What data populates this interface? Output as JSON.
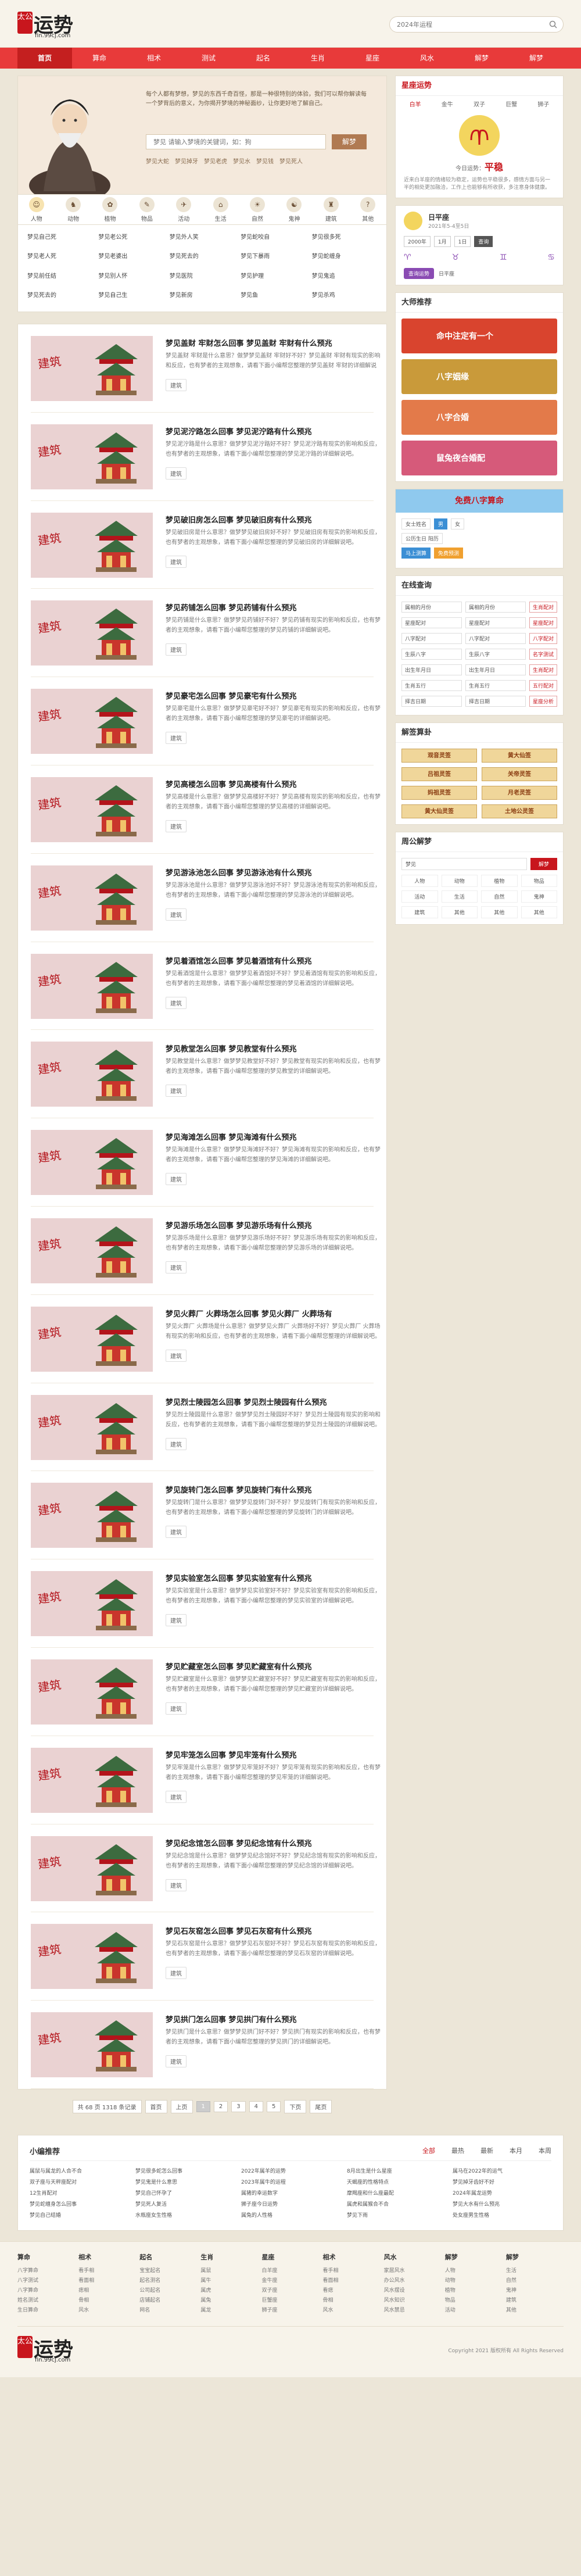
{
  "site": {
    "seal": "太公",
    "name": "运势",
    "domain": "fin.99cj.com"
  },
  "search": {
    "placeholder": "2024年运程"
  },
  "nav": [
    "首页",
    "算命",
    "相术",
    "测试",
    "起名",
    "生肖",
    "星座",
    "风水",
    "解梦",
    "解梦"
  ],
  "hero": {
    "intro": "每个人都有梦想，梦见的东西千奇百怪，那是一种很特别的体验，我们可以帮你解读每一个梦背后的意义，为你揭开梦境的神秘面纱，让你更好地了解自己。",
    "search_placeholder": "梦见 请输入梦境的关键词，如：狗",
    "button": "解梦",
    "hot": [
      "梦见大蛇",
      "梦见掉牙",
      "梦见老虎",
      "梦见水",
      "梦见钱",
      "梦见死人"
    ]
  },
  "categories": [
    {
      "label": "人物",
      "icon": "person-icon"
    },
    {
      "label": "动物",
      "icon": "animal-icon"
    },
    {
      "label": "植物",
      "icon": "plant-icon"
    },
    {
      "label": "物品",
      "icon": "item-icon"
    },
    {
      "label": "活动",
      "icon": "activity-icon"
    },
    {
      "label": "生活",
      "icon": "life-icon"
    },
    {
      "label": "自然",
      "icon": "nature-icon"
    },
    {
      "label": "鬼神",
      "icon": "ghost-icon"
    },
    {
      "label": "建筑",
      "icon": "building-icon"
    },
    {
      "label": "其他",
      "icon": "other-icon"
    }
  ],
  "tags": [
    "梦见自己死",
    "梦见老公死",
    "梦见外人笑",
    "梦见蛇咬自",
    "梦见很多死",
    "梦见老人死",
    "梦见老婆出",
    "梦见死去的",
    "梦见下暴雨",
    "梦见蛇缠身",
    "梦见前任结",
    "梦见别人怀",
    "梦见医院",
    "梦见护理",
    "梦见鬼追",
    "梦见死去的",
    "梦见自己生",
    "梦见新房",
    "梦见鱼",
    "梦见杀鸡"
  ],
  "articles": [
    {
      "title": "梦见盖财 牢财怎么回事 梦见盖财 牢财有什么预兆",
      "desc": "梦见盖财 牢财是什么意思？做梦梦见盖财 牢财好不好？梦见盖财 牢财有现实的影响和反应，也有梦者的主观想象，请看下面小编帮您整理的梦见盖财 牢财的详细解说吧。",
      "tag": "建筑"
    },
    {
      "title": "梦见泥泞路怎么回事 梦见泥泞路有什么预兆",
      "desc": "梦见泥泞路是什么意思？做梦梦见泥泞路好不好？梦见泥泞路有现实的影响和反应，也有梦者的主观想象，请看下面小编帮您整理的梦见泥泞路的详细解说吧。",
      "tag": "建筑"
    },
    {
      "title": "梦见破旧房怎么回事 梦见破旧房有什么预兆",
      "desc": "梦见破旧房是什么意思？做梦梦见破旧房好不好？梦见破旧房有现实的影响和反应，也有梦者的主观想象，请看下面小编帮您整理的梦见破旧房的详细解说吧。",
      "tag": "建筑"
    },
    {
      "title": "梦见药铺怎么回事 梦见药铺有什么预兆",
      "desc": "梦见药铺是什么意思？做梦梦见药铺好不好？梦见药铺有现实的影响和反应，也有梦者的主观想象，请看下面小编帮您整理的梦见药铺的详细解说吧。",
      "tag": "建筑"
    },
    {
      "title": "梦见豪宅怎么回事 梦见豪宅有什么预兆",
      "desc": "梦见豪宅是什么意思？做梦梦见豪宅好不好？梦见豪宅有现实的影响和反应，也有梦者的主观想象，请看下面小编帮您整理的梦见豪宅的详细解说吧。",
      "tag": "建筑"
    },
    {
      "title": "梦见高楼怎么回事 梦见高楼有什么预兆",
      "desc": "梦见高楼是什么意思？做梦梦见高楼好不好？梦见高楼有现实的影响和反应，也有梦者的主观想象，请看下面小编帮您整理的梦见高楼的详细解说吧。",
      "tag": "建筑"
    },
    {
      "title": "梦见游泳池怎么回事 梦见游泳池有什么预兆",
      "desc": "梦见游泳池是什么意思？做梦梦见游泳池好不好？梦见游泳池有现实的影响和反应，也有梦者的主观想象，请看下面小编帮您整理的梦见游泳池的详细解说吧。",
      "tag": "建筑"
    },
    {
      "title": "梦见着酒馆怎么回事 梦见着酒馆有什么预兆",
      "desc": "梦见着酒馆是什么意思？做梦梦见着酒馆好不好？梦见着酒馆有现实的影响和反应，也有梦者的主观想象，请看下面小编帮您整理的梦见着酒馆的详细解说吧。",
      "tag": "建筑"
    },
    {
      "title": "梦见教堂怎么回事 梦见教堂有什么预兆",
      "desc": "梦见教堂是什么意思？做梦梦见教堂好不好？梦见教堂有现实的影响和反应，也有梦者的主观想象，请看下面小编帮您整理的梦见教堂的详细解说吧。",
      "tag": "建筑"
    },
    {
      "title": "梦见海滩怎么回事 梦见海滩有什么预兆",
      "desc": "梦见海滩是什么意思？做梦梦见海滩好不好？梦见海滩有现实的影响和反应，也有梦者的主观想象，请看下面小编帮您整理的梦见海滩的详细解说吧。",
      "tag": "建筑"
    },
    {
      "title": "梦见游乐场怎么回事 梦见游乐场有什么预兆",
      "desc": "梦见游乐场是什么意思？做梦梦见游乐场好不好？梦见游乐场有现实的影响和反应，也有梦者的主观想象，请看下面小编帮您整理的梦见游乐场的详细解说吧。",
      "tag": "建筑"
    },
    {
      "title": "梦见火葬厂 火葬场怎么回事 梦见火葬厂 火葬场有",
      "desc": "梦见火葬厂 火葬场是什么意思？做梦梦见火葬厂 火葬场好不好？梦见火葬厂 火葬场有现实的影响和反应，也有梦者的主观想象，请看下面小编帮您整理的详细解说吧。",
      "tag": "建筑"
    },
    {
      "title": "梦见烈士陵园怎么回事 梦见烈士陵园有什么预兆",
      "desc": "梦见烈士陵园是什么意思？做梦梦见烈士陵园好不好？梦见烈士陵园有现实的影响和反应，也有梦者的主观想象，请看下面小编帮您整理的梦见烈士陵园的详细解说吧。",
      "tag": "建筑"
    },
    {
      "title": "梦见旋转门怎么回事 梦见旋转门有什么预兆",
      "desc": "梦见旋转门是什么意思？做梦梦见旋转门好不好？梦见旋转门有现实的影响和反应，也有梦者的主观想象，请看下面小编帮您整理的梦见旋转门的详细解说吧。",
      "tag": "建筑"
    },
    {
      "title": "梦见实验室怎么回事 梦见实验室有什么预兆",
      "desc": "梦见实验室是什么意思？做梦梦见实验室好不好？梦见实验室有现实的影响和反应，也有梦者的主观想象，请看下面小编帮您整理的梦见实验室的详细解说吧。",
      "tag": "建筑"
    },
    {
      "title": "梦见贮藏室怎么回事 梦见贮藏室有什么预兆",
      "desc": "梦见贮藏室是什么意思？做梦梦见贮藏室好不好？梦见贮藏室有现实的影响和反应，也有梦者的主观想象，请看下面小编帮您整理的梦见贮藏室的详细解说吧。",
      "tag": "建筑"
    },
    {
      "title": "梦见牢笼怎么回事 梦见牢笼有什么预兆",
      "desc": "梦见牢笼是什么意思？做梦梦见牢笼好不好？梦见牢笼有现实的影响和反应，也有梦者的主观想象，请看下面小编帮您整理的梦见牢笼的详细解说吧。",
      "tag": "建筑"
    },
    {
      "title": "梦见纪念馆怎么回事 梦见纪念馆有什么预兆",
      "desc": "梦见纪念馆是什么意思？做梦梦见纪念馆好不好？梦见纪念馆有现实的影响和反应，也有梦者的主观想象，请看下面小编帮您整理的梦见纪念馆的详细解说吧。",
      "tag": "建筑"
    },
    {
      "title": "梦见石灰窑怎么回事 梦见石灰窑有什么预兆",
      "desc": "梦见石灰窑是什么意思？做梦梦见石灰窑好不好？梦见石灰窑有现实的影响和反应，也有梦者的主观想象，请看下面小编帮您整理的梦见石灰窑的详细解说吧。",
      "tag": "建筑"
    },
    {
      "title": "梦见拱门怎么回事 梦见拱门有什么预兆",
      "desc": "梦见拱门是什么意思？做梦梦见拱门好不好？梦见拱门有现实的影响和反应，也有梦者的主观想象，请看下面小编帮您整理的梦见拱门的详细解说吧。",
      "tag": "建筑"
    }
  ],
  "thumb_text": "建筑",
  "pager": {
    "info": "共 68 页 1318 条记录",
    "first": "首页",
    "prev": "上页",
    "pages": [
      "1",
      "2",
      "3",
      "4",
      "5"
    ],
    "next": "下页",
    "last": "尾页"
  },
  "right": {
    "fortune_title": "星座运势",
    "zodiac": [
      "白羊",
      "金牛",
      "双子",
      "巨蟹",
      "狮子"
    ],
    "luck_label": "今日运势：",
    "luck_value": "平稳",
    "fortune_text": "近来白羊座的情绪较为稳定，运势也平稳很多，感情方面与另一半的相处更加融洽，工作上也能够有所收获，多注意身体健康。",
    "date_title": "日平座",
    "date_sub": "2021年5-4至5日",
    "sel": [
      "2000年",
      "1月",
      "1日",
      "查询"
    ],
    "signs": [
      "♈",
      "♉",
      "♊",
      "♋"
    ],
    "purple_btn": "查询运势",
    "purple_link": "日平座",
    "masters_title": "大师推荐",
    "banners": [
      "命中注定有一个",
      "八字姻缘",
      "八字合婚",
      "鼠兔夜合婚配"
    ],
    "bazi_title": "免费八字算命",
    "bazi_rows": [
      [
        "女士姓名",
        "男",
        "女"
      ],
      [
        "公历生日 阳历"
      ]
    ],
    "bazi_btns": [
      "马上测算",
      "免费预测"
    ],
    "online_title": "在线查询",
    "online_rows": [
      [
        "属相的月份",
        "生肖配对"
      ],
      [
        "星座配对",
        "星座配对"
      ],
      [
        "八字配对",
        "八字配对"
      ],
      [
        "生辰八字",
        "名字测试"
      ],
      [
        "出生年月日",
        "生肖配对"
      ],
      [
        "生肖五行",
        "五行配对"
      ],
      [
        "择吉日期",
        "星座分析"
      ]
    ],
    "qian_title": "解签算卦",
    "qian": [
      "观音灵签",
      "黄大仙签",
      "吕祖灵签",
      "关帝灵签",
      "妈祖灵签",
      "月老灵签",
      "黄大仙灵签",
      "土地公灵签"
    ],
    "dream_title": "周公解梦",
    "dream_placeholder": "梦见",
    "dream_btn": "解梦",
    "dream_cats": [
      "人物",
      "动物",
      "植物",
      "物品",
      "活动",
      "生活",
      "自然",
      "鬼神",
      "建筑",
      "其他",
      "其他",
      "其他"
    ]
  },
  "rec": {
    "title": "小编推荐",
    "tabs": [
      "全部",
      "最热",
      "最新",
      "本月",
      "本周"
    ],
    "items": [
      "属鼠与属龙的人合不合",
      "梦见很多蛇怎么回事",
      "2022年属羊的运势",
      "8月出生是什么星座",
      "属马在2022年的运气",
      "双子座与天秤座配对",
      "梦见鬼是什么意思",
      "2023年属牛的运程",
      "天蝎座的性格特点",
      "梦见掉牙齿好不好",
      "12生肖配对",
      "梦见自己怀孕了",
      "属猪的幸运数字",
      "摩羯座和什么座最配",
      "2024年属龙运势",
      "梦见蛇缠身怎么回事",
      "梦见死人复活",
      "狮子座今日运势",
      "属虎和属猴合不合",
      "梦见大水有什么预兆",
      "梦见自己结婚",
      "水瓶座女生性格",
      "属兔的人性格",
      "梦见下雨",
      "处女座男生性格"
    ]
  },
  "footer": {
    "cols": [
      {
        "title": "算命",
        "items": [
          "八字算命",
          "八字测试",
          "八字算命",
          "姓名测试",
          "生日算命"
        ]
      },
      {
        "title": "相术",
        "items": [
          "看手相",
          "看面相",
          "痣相",
          "骨相",
          "风水"
        ]
      },
      {
        "title": "起名",
        "items": [
          "宝宝起名",
          "起名测名",
          "公司起名",
          "店铺起名",
          "网名"
        ]
      },
      {
        "title": "生肖",
        "items": [
          "属鼠",
          "属牛",
          "属虎",
          "属兔",
          "属龙"
        ]
      },
      {
        "title": "星座",
        "items": [
          "白羊座",
          "金牛座",
          "双子座",
          "巨蟹座",
          "狮子座"
        ]
      },
      {
        "title": "相术",
        "items": [
          "看手相",
          "看面相",
          "看痣",
          "骨相",
          "风水"
        ]
      },
      {
        "title": "风水",
        "items": [
          "家居风水",
          "办公风水",
          "风水摆设",
          "风水知识",
          "风水禁忌"
        ]
      },
      {
        "title": "解梦",
        "items": [
          "人物",
          "动物",
          "植物",
          "物品",
          "活动"
        ]
      },
      {
        "title": "解梦",
        "items": [
          "生活",
          "自然",
          "鬼神",
          "建筑",
          "其他"
        ]
      }
    ],
    "copyright": "Copyright 2021 版权所有 All Rights Reserved"
  }
}
